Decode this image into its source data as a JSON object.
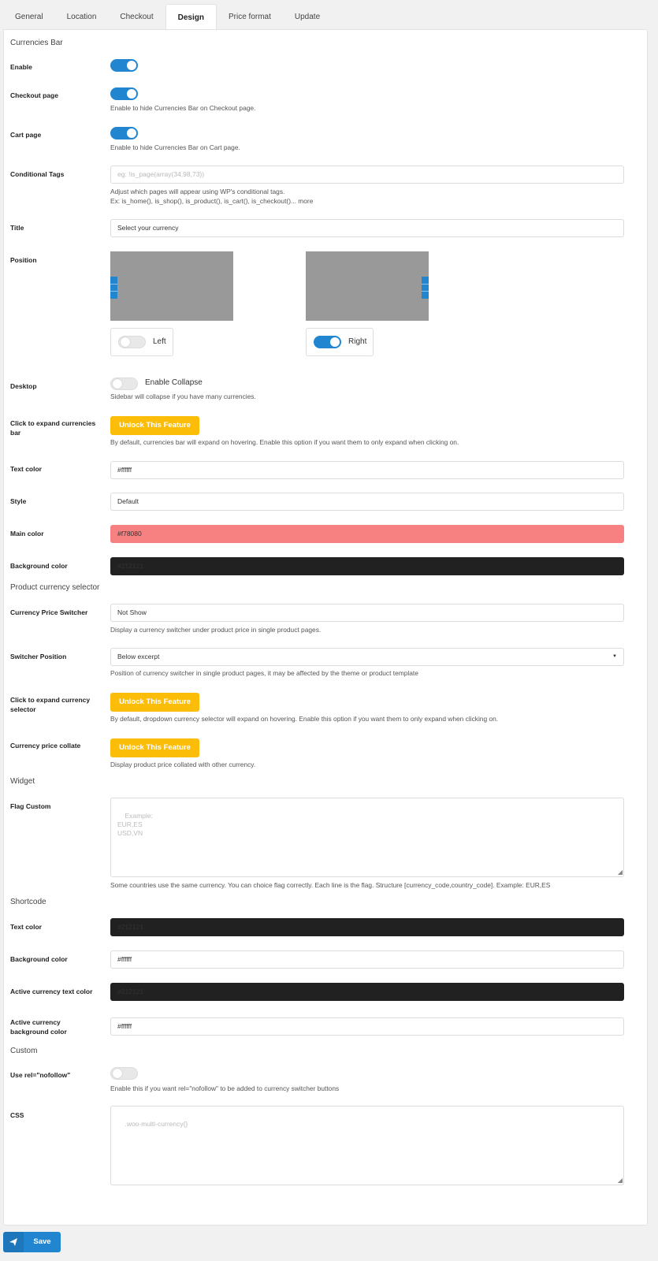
{
  "tabs": [
    "General",
    "Location",
    "Checkout",
    "Design",
    "Price format",
    "Update"
  ],
  "currencies_bar": {
    "heading": "Currencies Bar",
    "enable_label": "Enable",
    "checkout_label": "Checkout page",
    "checkout_desc": "Enable to hide Currencies Bar on Checkout page.",
    "cart_label": "Cart page",
    "cart_desc": "Enable to hide Currencies Bar on Cart page.",
    "conditional_label": "Conditional Tags",
    "conditional_placeholder": "eg: !is_page(array(34,98,73))",
    "conditional_desc1": "Adjust which pages will appear using WP's conditional tags.",
    "conditional_desc2": "Ex: is_home(), is_shop(), is_product(), is_cart(), is_checkout()... more",
    "title_label": "Title",
    "title_value": "Select your currency",
    "position_label": "Position",
    "position_left": "Left",
    "position_right": "Right",
    "desktop_label": "Desktop",
    "collapse_label": "Enable Collapse",
    "collapse_desc": "Sidebar will collapse if you have many currencies.",
    "click_expand_label": "Click to expand currencies bar",
    "unlock_label": "Unlock This Feature",
    "click_expand_desc": "By default, currencies bar will expand on hovering. Enable this option if you want them to only expand when clicking on.",
    "text_color_label": "Text color",
    "text_color_value": "#ffffff",
    "style_label": "Style",
    "style_value": "Default",
    "main_color_label": "Main color",
    "main_color_value": "#f78080",
    "bg_color_label": "Background color",
    "bg_color_value": "#212121"
  },
  "product_selector": {
    "heading": "Product currency selector",
    "price_switcher_label": "Currency Price Switcher",
    "price_switcher_value": "Not Show",
    "price_switcher_desc": "Display a currency switcher under product price in single product pages.",
    "switcher_position_label": "Switcher Position",
    "switcher_position_value": "Below excerpt",
    "switcher_position_desc": "Position of currency switcher in single product pages, it may be affected by the theme or product template",
    "click_expand_label": "Click to expand currency selector",
    "unlock_label": "Unlock This Feature",
    "click_expand_desc": "By default, dropdown currency selector will expand on hovering. Enable this option if you want them to only expand when clicking on.",
    "collate_label": "Currency price collate",
    "unlock_label2": "Unlock This Feature",
    "collate_desc": "Display product price collated with other currency."
  },
  "widget": {
    "heading": "Widget",
    "flag_label": "Flag Custom",
    "flag_placeholder": "Example:\nEUR,ES\nUSD,VN",
    "flag_desc": "Some countries use the same currency. You can choice flag correctly. Each line is the flag. Structure [currency_code,country_code]. Example: EUR,ES"
  },
  "shortcode": {
    "heading": "Shortcode",
    "text_color_label": "Text color",
    "text_color_value": "#212121",
    "bg_color_label": "Background color",
    "bg_color_value": "#ffffff",
    "active_text_label": "Active currency text color",
    "active_text_value": "#212121",
    "active_bg_label": "Active currency background color",
    "active_bg_value": "#ffffff"
  },
  "custom": {
    "heading": "Custom",
    "nofollow_label": "Use rel=\"nofollow\"",
    "nofollow_desc": "Enable this if you want rel=\"nofollow\" to be added to currency switcher buttons",
    "css_label": "CSS",
    "css_placeholder": ".woo-multi-currency{}"
  },
  "save_label": "Save",
  "colors": {
    "accent": "#2185d0",
    "unlock": "#fbbd08",
    "main": "#f78080",
    "dark": "#212121"
  }
}
